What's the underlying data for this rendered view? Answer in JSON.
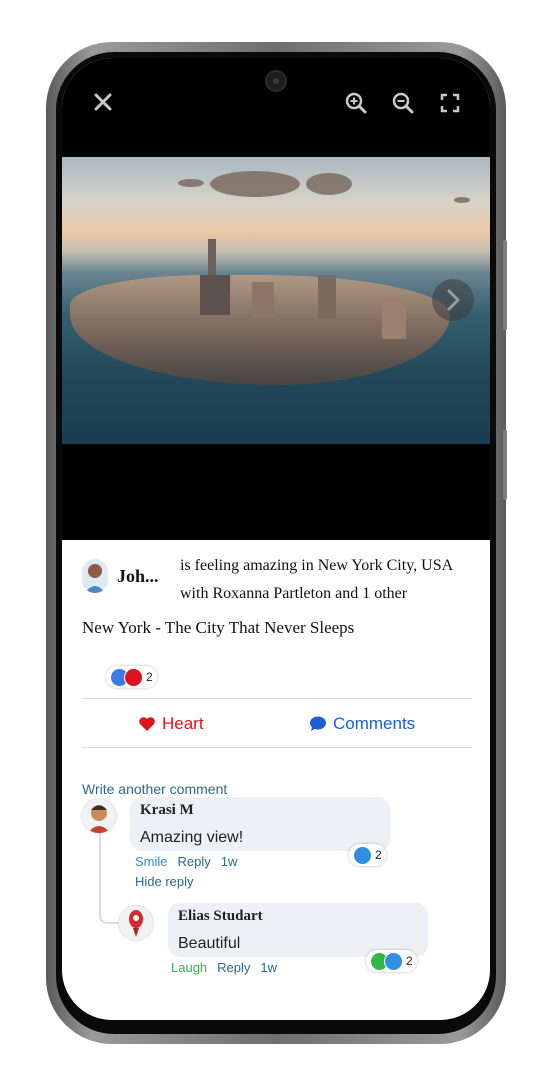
{
  "viewer": {
    "close_icon": "close-icon",
    "zoom_in_icon": "zoom-in-icon",
    "zoom_out_icon": "zoom-out-icon",
    "fullscreen_icon": "fullscreen-icon",
    "next_icon": "chevron-right-icon"
  },
  "post": {
    "author": "Joh...",
    "status_line1": "is feeling amazing in New York City, USA",
    "status_line2": "with Roxanna Partleton and 1 other",
    "title": "New York - The City That Never Sleeps",
    "reaction_count": "2"
  },
  "actions": {
    "heart_label": "Heart",
    "comments_label": "Comments"
  },
  "comments": {
    "write_link": "Write another comment",
    "items": [
      {
        "name": "Krasi M",
        "text": "Amazing view!",
        "react_label": "Smile",
        "reply_label": "Reply",
        "time": "1w",
        "hide_reply_label": "Hide reply",
        "reaction_count": "2",
        "replies": [
          {
            "name": "Elias Studart",
            "text": "Beautiful",
            "react_label": "Laugh",
            "reply_label": "Reply",
            "time": "1w",
            "reaction_count": "2"
          }
        ]
      }
    ]
  },
  "colors": {
    "heart": "#e0131d",
    "comments": "#1a5fd6",
    "smile": "#3a8ad0",
    "laugh": "#34b54a",
    "link": "#2c6a8d"
  }
}
